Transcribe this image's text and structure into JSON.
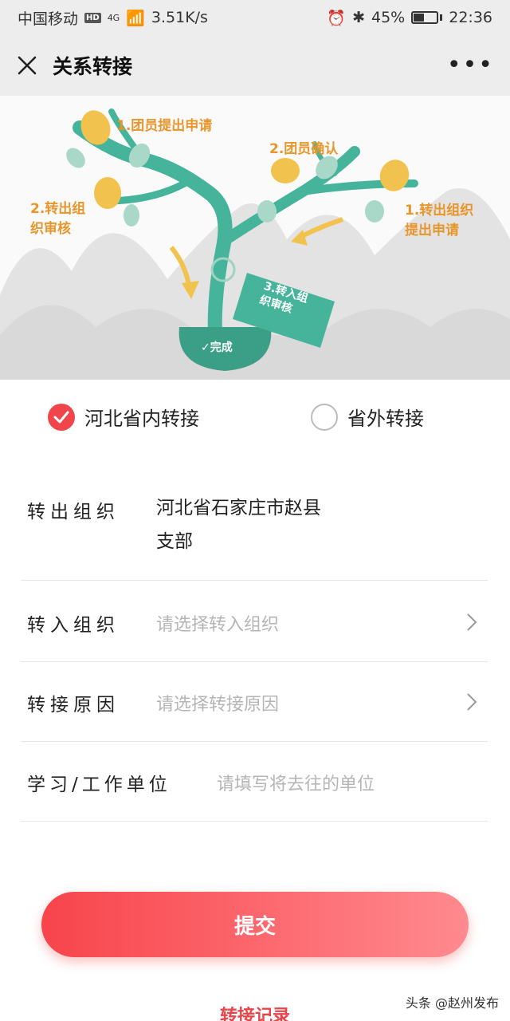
{
  "status_bar": {
    "carrier": "中国移动",
    "hd": "HD",
    "network": "4G",
    "speed": "3.51K/s",
    "battery_percent": "45%",
    "battery_level": 0.45,
    "time": "22:36"
  },
  "title_bar": {
    "title": "关系转接",
    "close_icon": "close-icon",
    "more_icon": "more-icon",
    "more_glyph": "•••"
  },
  "illustration": {
    "step1_left": "1.团员提出申请",
    "step2_center": "2.团员确认",
    "step2_left_line1": "2.转出组",
    "step2_left_line2": "织审核",
    "step1_right_line1": "1.转出组织",
    "step1_right_line2": "提出申请",
    "step3_tag_line1": "3.转入组",
    "step3_tag_line2": "织审核",
    "complete": "✓完成",
    "colors": {
      "tree": "#45b49a",
      "leaf": "#f2c24f",
      "accent": "#e8962c",
      "mountain": "#e0e0e0"
    }
  },
  "transfer_type": {
    "options": [
      {
        "label": "河北省内转接",
        "selected": true
      },
      {
        "label": "省外转接",
        "selected": false
      }
    ]
  },
  "form": {
    "out_org": {
      "label": "转出组织",
      "value_line1": "河北省石家庄市赵县",
      "value_line2": "支部"
    },
    "in_org": {
      "label": "转入组织",
      "placeholder": "请选择转入组织"
    },
    "reason": {
      "label": "转接原因",
      "placeholder": "请选择转接原因"
    },
    "work_unit": {
      "label": "学习/工作单位",
      "placeholder": "请填写将去往的单位"
    }
  },
  "actions": {
    "submit_label": "提交",
    "records_label": "转接记录"
  },
  "watermark": "头条 @赵州发布",
  "colors": {
    "primary": "#f0454b",
    "background": "#ededed"
  }
}
